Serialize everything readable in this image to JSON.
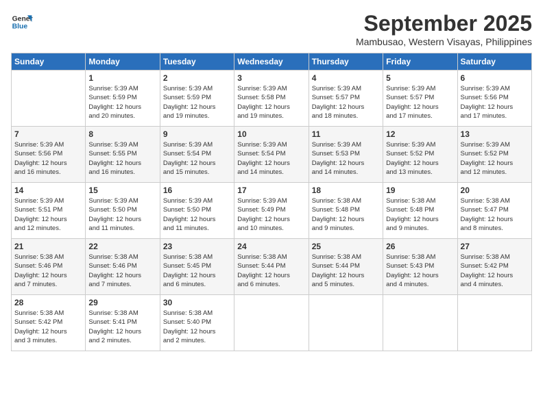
{
  "logo": {
    "line1": "General",
    "line2": "Blue"
  },
  "title": "September 2025",
  "subtitle": "Mambusao, Western Visayas, Philippines",
  "days_of_week": [
    "Sunday",
    "Monday",
    "Tuesday",
    "Wednesday",
    "Thursday",
    "Friday",
    "Saturday"
  ],
  "weeks": [
    [
      {
        "day": "",
        "info": ""
      },
      {
        "day": "1",
        "info": "Sunrise: 5:39 AM\nSunset: 5:59 PM\nDaylight: 12 hours\nand 20 minutes."
      },
      {
        "day": "2",
        "info": "Sunrise: 5:39 AM\nSunset: 5:59 PM\nDaylight: 12 hours\nand 19 minutes."
      },
      {
        "day": "3",
        "info": "Sunrise: 5:39 AM\nSunset: 5:58 PM\nDaylight: 12 hours\nand 19 minutes."
      },
      {
        "day": "4",
        "info": "Sunrise: 5:39 AM\nSunset: 5:57 PM\nDaylight: 12 hours\nand 18 minutes."
      },
      {
        "day": "5",
        "info": "Sunrise: 5:39 AM\nSunset: 5:57 PM\nDaylight: 12 hours\nand 17 minutes."
      },
      {
        "day": "6",
        "info": "Sunrise: 5:39 AM\nSunset: 5:56 PM\nDaylight: 12 hours\nand 17 minutes."
      }
    ],
    [
      {
        "day": "7",
        "info": "Sunrise: 5:39 AM\nSunset: 5:56 PM\nDaylight: 12 hours\nand 16 minutes."
      },
      {
        "day": "8",
        "info": "Sunrise: 5:39 AM\nSunset: 5:55 PM\nDaylight: 12 hours\nand 16 minutes."
      },
      {
        "day": "9",
        "info": "Sunrise: 5:39 AM\nSunset: 5:54 PM\nDaylight: 12 hours\nand 15 minutes."
      },
      {
        "day": "10",
        "info": "Sunrise: 5:39 AM\nSunset: 5:54 PM\nDaylight: 12 hours\nand 14 minutes."
      },
      {
        "day": "11",
        "info": "Sunrise: 5:39 AM\nSunset: 5:53 PM\nDaylight: 12 hours\nand 14 minutes."
      },
      {
        "day": "12",
        "info": "Sunrise: 5:39 AM\nSunset: 5:52 PM\nDaylight: 12 hours\nand 13 minutes."
      },
      {
        "day": "13",
        "info": "Sunrise: 5:39 AM\nSunset: 5:52 PM\nDaylight: 12 hours\nand 12 minutes."
      }
    ],
    [
      {
        "day": "14",
        "info": "Sunrise: 5:39 AM\nSunset: 5:51 PM\nDaylight: 12 hours\nand 12 minutes."
      },
      {
        "day": "15",
        "info": "Sunrise: 5:39 AM\nSunset: 5:50 PM\nDaylight: 12 hours\nand 11 minutes."
      },
      {
        "day": "16",
        "info": "Sunrise: 5:39 AM\nSunset: 5:50 PM\nDaylight: 12 hours\nand 11 minutes."
      },
      {
        "day": "17",
        "info": "Sunrise: 5:39 AM\nSunset: 5:49 PM\nDaylight: 12 hours\nand 10 minutes."
      },
      {
        "day": "18",
        "info": "Sunrise: 5:38 AM\nSunset: 5:48 PM\nDaylight: 12 hours\nand 9 minutes."
      },
      {
        "day": "19",
        "info": "Sunrise: 5:38 AM\nSunset: 5:48 PM\nDaylight: 12 hours\nand 9 minutes."
      },
      {
        "day": "20",
        "info": "Sunrise: 5:38 AM\nSunset: 5:47 PM\nDaylight: 12 hours\nand 8 minutes."
      }
    ],
    [
      {
        "day": "21",
        "info": "Sunrise: 5:38 AM\nSunset: 5:46 PM\nDaylight: 12 hours\nand 7 minutes."
      },
      {
        "day": "22",
        "info": "Sunrise: 5:38 AM\nSunset: 5:46 PM\nDaylight: 12 hours\nand 7 minutes."
      },
      {
        "day": "23",
        "info": "Sunrise: 5:38 AM\nSunset: 5:45 PM\nDaylight: 12 hours\nand 6 minutes."
      },
      {
        "day": "24",
        "info": "Sunrise: 5:38 AM\nSunset: 5:44 PM\nDaylight: 12 hours\nand 6 minutes."
      },
      {
        "day": "25",
        "info": "Sunrise: 5:38 AM\nSunset: 5:44 PM\nDaylight: 12 hours\nand 5 minutes."
      },
      {
        "day": "26",
        "info": "Sunrise: 5:38 AM\nSunset: 5:43 PM\nDaylight: 12 hours\nand 4 minutes."
      },
      {
        "day": "27",
        "info": "Sunrise: 5:38 AM\nSunset: 5:42 PM\nDaylight: 12 hours\nand 4 minutes."
      }
    ],
    [
      {
        "day": "28",
        "info": "Sunrise: 5:38 AM\nSunset: 5:42 PM\nDaylight: 12 hours\nand 3 minutes."
      },
      {
        "day": "29",
        "info": "Sunrise: 5:38 AM\nSunset: 5:41 PM\nDaylight: 12 hours\nand 2 minutes."
      },
      {
        "day": "30",
        "info": "Sunrise: 5:38 AM\nSunset: 5:40 PM\nDaylight: 12 hours\nand 2 minutes."
      },
      {
        "day": "",
        "info": ""
      },
      {
        "day": "",
        "info": ""
      },
      {
        "day": "",
        "info": ""
      },
      {
        "day": "",
        "info": ""
      }
    ]
  ]
}
